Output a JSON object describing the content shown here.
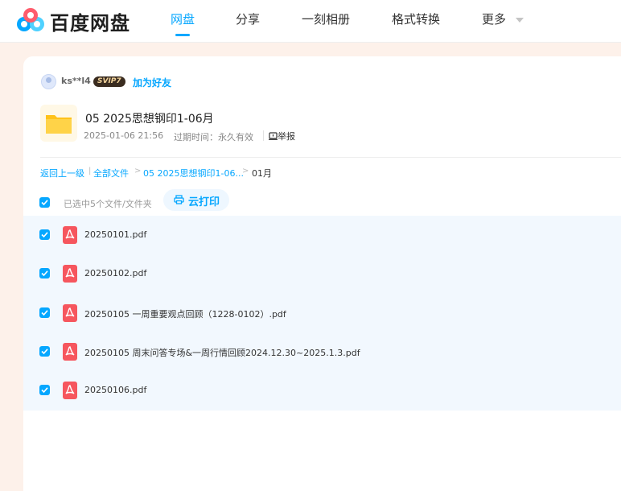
{
  "brand": {
    "name": "百度网盘",
    "logo_icon": "baidu-netdisk-logo-icon"
  },
  "nav": {
    "items": [
      {
        "label": "网盘",
        "active": true
      },
      {
        "label": "分享",
        "active": false
      },
      {
        "label": "一刻相册",
        "active": false
      },
      {
        "label": "格式转换",
        "active": false
      },
      {
        "label": "更多",
        "active": false
      }
    ],
    "more_icon": "chevron-down-icon",
    "accent_color": "#06a7ff"
  },
  "sharer": {
    "username": "ks**l4",
    "vip_badge": "SVIP7",
    "add_friend_label": "加为好友"
  },
  "folder": {
    "name": "05 2025思想钢印1-06月",
    "date": "2025-01-06 21:56",
    "expiry_label": "过期时间：永久有效",
    "report_label": "举报"
  },
  "breadcrumb": {
    "back_label": "返回上一级",
    "all_files_label": "全部文件",
    "parent_label": "05 2025思想钢印1-06...",
    "current_label": "01月"
  },
  "selection": {
    "summary": "已选中5个文件/文件夹",
    "cloud_print_label": "云打印"
  },
  "files": [
    {
      "name": "20250101.pdf",
      "checked": true
    },
    {
      "name": "20250102.pdf",
      "checked": true
    },
    {
      "name": "20250105 一周重要观点回顾（1228-0102）.pdf",
      "checked": true
    },
    {
      "name": "20250105 周末问答专场&一周行情回顾2024.12.30~2025.1.3.pdf",
      "checked": true
    },
    {
      "name": "20250106.pdf",
      "checked": true
    }
  ]
}
